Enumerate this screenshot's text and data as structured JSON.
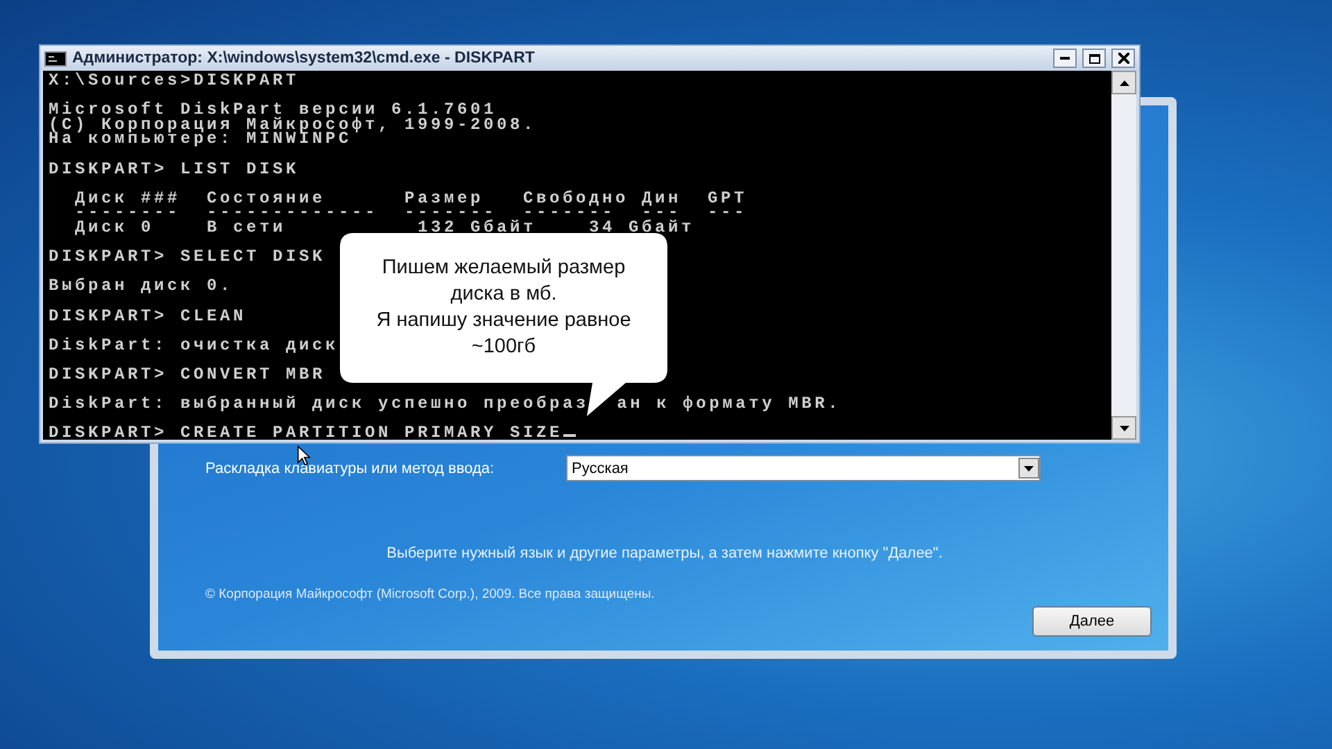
{
  "setup_window": {
    "layout_label": "Раскладка клавиатуры или метод ввода:",
    "layout_select": {
      "value": "Русская"
    },
    "hint": "Выберите нужный язык и другие параметры, а затем нажмите кнопку \"Далее\".",
    "copyright": "© Корпорация Майкрософт (Microsoft Corp.), 2009. Все права защищены.",
    "next_button": "Далее"
  },
  "console_window": {
    "title": "Администратор: X:\\windows\\system32\\cmd.exe - DISKPART",
    "blocks": [
      [
        {
          "text": "X:\\Sources>DISKPART"
        }
      ],
      [
        {
          "text": "Microsoft DiskPart версии 6.1.7601"
        },
        {
          "text": "(C) Корпорация Майкрософт, 1999-2008."
        },
        {
          "text": "На компьютере: MINWINPC"
        }
      ],
      [
        {
          "text": "DISKPART> LIST DISK"
        }
      ],
      [
        {
          "text": "  Диск ###  Состояние      Размер   Свободно Дин  GPT"
        },
        {
          "text": "  --------  -------------  -------  -------  ---  ---"
        },
        {
          "text": "  Диск 0    В сети          132 Gбайт    34 Gбайт"
        }
      ],
      [
        {
          "text": "DISKPART> SELECT DISK"
        }
      ],
      [
        {
          "text": "Выбран диск 0."
        }
      ],
      [
        {
          "text": "DISKPART> CLEAN"
        }
      ],
      [
        {
          "text": "DiskPart: очистка диск"
        }
      ],
      [
        {
          "text": "DISKPART> CONVERT MBR"
        }
      ],
      [
        {
          "text": "DiskPart: выбранный диск успешно преобраз",
          "tail": "ан к формату MBR."
        }
      ],
      [
        {
          "text": "DISKPART> CREATE PARTITION PRIMARY SIZE"
        }
      ]
    ]
  },
  "callout": {
    "text": "Пишем желаемый размер\nдиска в мб.\nЯ напишу значение равное\n~100гб"
  }
}
